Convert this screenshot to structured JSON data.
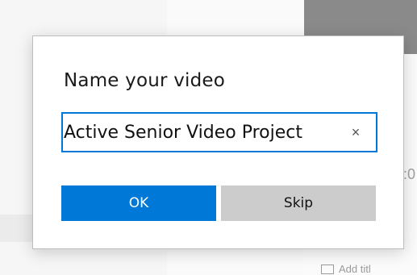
{
  "background": {
    "time_fragment": ":0",
    "add_title_label": "Add titl"
  },
  "dialog": {
    "title": "Name your video",
    "input_value": "Active Senior Video Project",
    "clear_glyph": "×",
    "ok_label": "OK",
    "skip_label": "Skip"
  },
  "colors": {
    "accent": "#0078d7",
    "skip_button": "#cccccc"
  },
  "icons": {
    "clear": "close-icon",
    "add_title": "text-box-icon"
  }
}
